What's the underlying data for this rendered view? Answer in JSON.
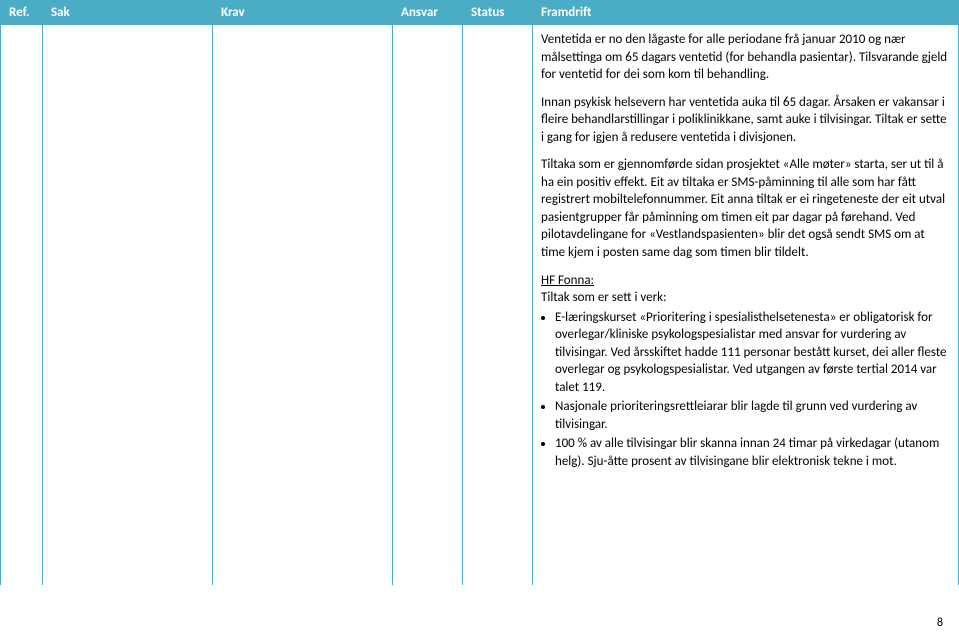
{
  "headers": {
    "ref": "Ref.",
    "sak": "Sak",
    "krav": "Krav",
    "ansvar": "Ansvar",
    "status": "Status",
    "framdrift": "Framdrift"
  },
  "framdrift": {
    "p1": "Ventetida er no den lågaste for alle periodane frå januar 2010 og nær målsettinga om 65 dagars ventetid (for behandla pasientar). Tilsvarande gjeld for ventetid for dei som kom til behandling.",
    "p2": "Innan psykisk helsevern har ventetida auka til 65 dagar. Årsaken er vakansar i fleire behandlarstillingar i poliklinikkane, samt auke i tilvisingar. Tiltak er sette i gang for igjen å redusere ventetida i divisjonen.",
    "p3": "Tiltaka som er gjennomførde sidan prosjektet «Alle møter» starta, ser ut til å ha ein positiv effekt. Eit av tiltaka er SMS-påminning til alle som har fått registrert mobiltelefonnummer. Eit anna tiltak er ei ringeteneste der eit utval pasientgrupper får påminning om timen eit par dagar på førehand. Ved pilotavdelingane for «Vestlandspasienten» blir det også sendt SMS om at time kjem i posten same dag som timen blir tildelt.",
    "hf_title": "HF Fonna:",
    "hf_sub": "Tiltak som er sett i verk:",
    "bullets": {
      "b1": "E-læringskurset «Prioritering i spesialisthelsetenesta» er obligatorisk for overlegar/kliniske psykologspesialistar med ansvar for vurdering av tilvisingar. Ved årsskiftet hadde 111 personar bestått kurset, dei aller fleste overlegar og psykologspesialistar. Ved utgangen av første tertial 2014 var talet 119.",
      "b2": "Nasjonale prioriteringsrettleiarar blir lagde til grunn ved vurdering  av tilvisingar.",
      "b3": "100 % av alle tilvisingar blir skanna innan 24 timar på virkedagar (utanom helg). Sju-åtte prosent av tilvisingane blir elektronisk tekne i mot."
    }
  },
  "page_number": "8"
}
